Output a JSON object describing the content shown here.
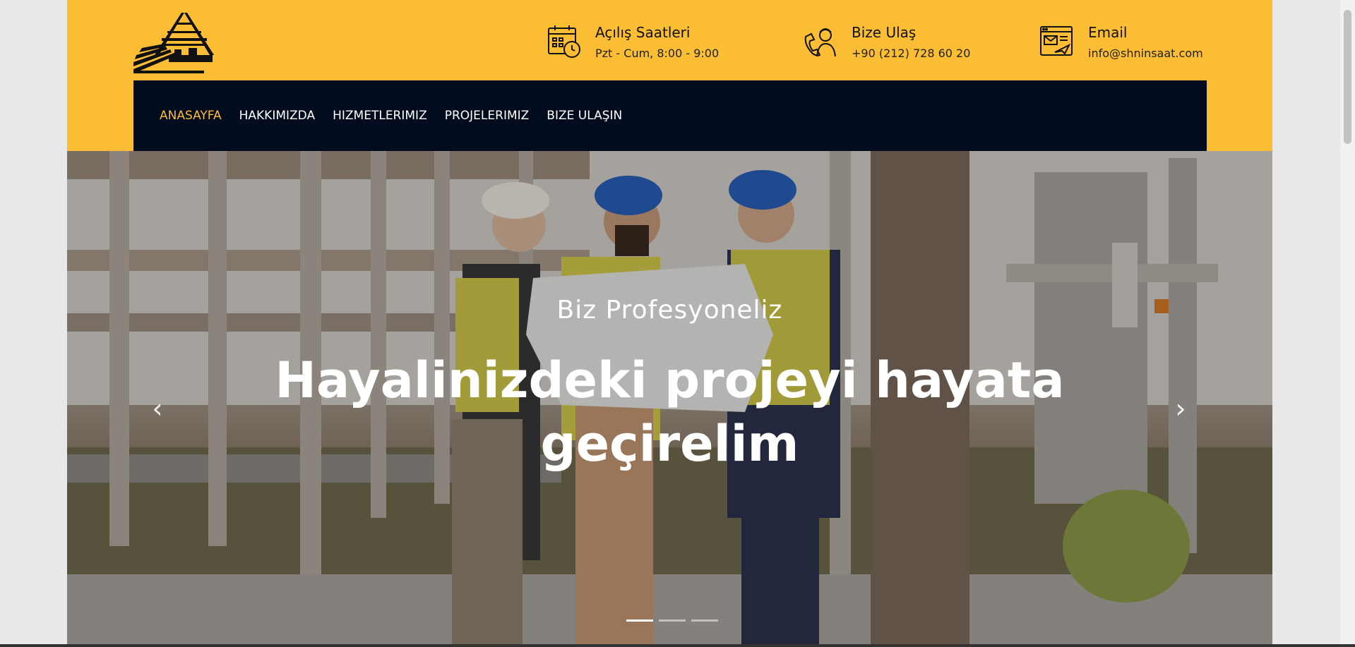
{
  "header": {
    "hours": {
      "title": "Açılış Saatleri",
      "value": "Pzt - Cum, 8:00 - 9:00",
      "icon": "calendar-clock-icon"
    },
    "contact": {
      "title": "Bize Ulaş",
      "value": "+90 (212) 728 60 20",
      "icon": "phone-person-icon"
    },
    "email": {
      "title": "Email",
      "value": "info@shninsaat.com",
      "icon": "email-window-icon"
    }
  },
  "nav": {
    "items": [
      {
        "label": "ANASAYFA",
        "active": true
      },
      {
        "label": "HAKKIMIZDA"
      },
      {
        "label": "HIZMETLERIMIZ"
      },
      {
        "label": "PROJELERIMIZ"
      },
      {
        "label": "BIZE ULAŞIN"
      }
    ]
  },
  "hero": {
    "subtitle": "Biz Profesyoneliz",
    "headline_line1": "Hayalinizdeki projeyi hayata",
    "headline_line2": "geçirelim",
    "prev_icon": "‹",
    "next_icon": "›",
    "slides": 3,
    "active_slide": 1
  },
  "colors": {
    "accent": "#fbbd34",
    "nav_bg": "#020c1e"
  }
}
